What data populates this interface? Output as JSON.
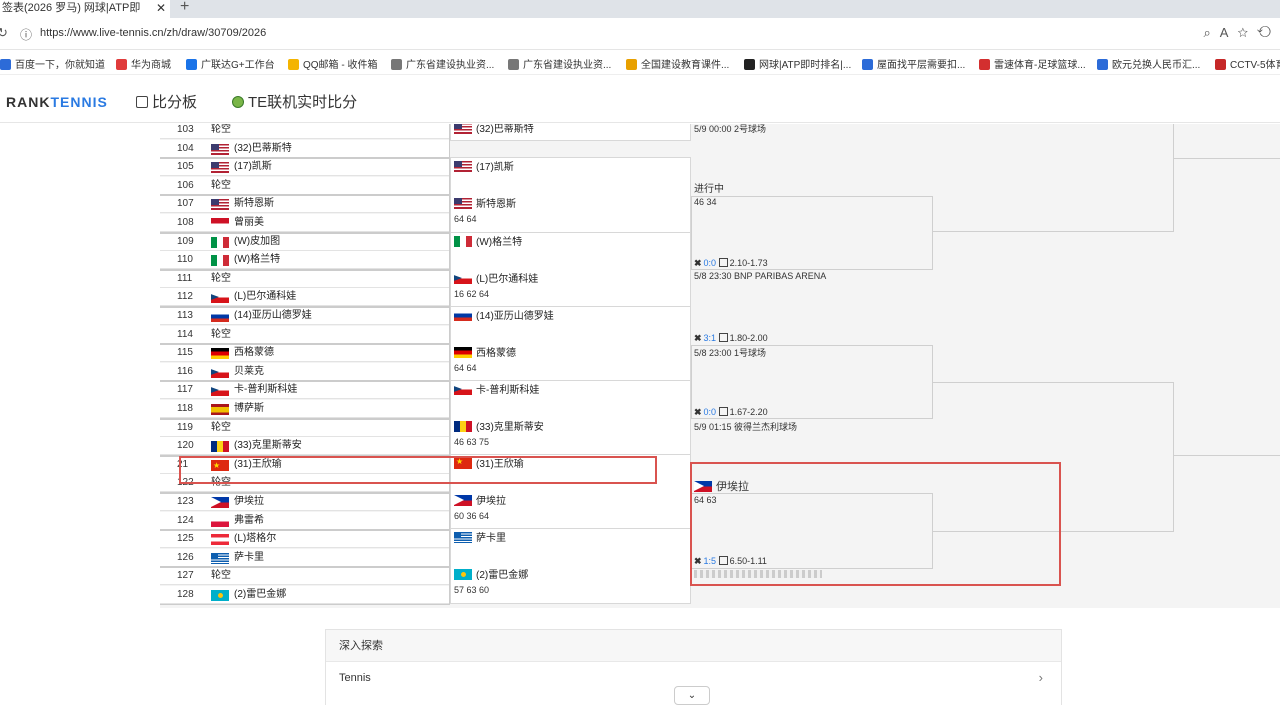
{
  "browser": {
    "tab_title": "签表(2026 罗马) 网球|ATP即",
    "tab_close": "✕",
    "new_tab": "+",
    "url": "https://www.live-tennis.cn/zh/draw/30709/2026",
    "bookmarks": [
      "百度一下，你就知道",
      "华为商城",
      "广联达G+工作台",
      "QQ邮箱 - 收件箱",
      "广东省建设执业资...",
      "广东省建设执业资...",
      "全国建设教育课件...",
      "网球|ATP即时排名|...",
      "屋面找平层需要扣...",
      "雷速体育-足球篮球...",
      "欧元兑换人民币汇...",
      "CCTV-5体育"
    ]
  },
  "site": {
    "logo_a": "RANK",
    "logo_b": "TENNIS",
    "nav_score": "比分板",
    "nav_live": "TE联机实时比分"
  },
  "draw": {
    "r1": [
      {
        "no": "103",
        "name": "轮空",
        "flag": ""
      },
      {
        "no": "104",
        "name": "(32)巴蒂斯特",
        "flag": "us"
      },
      {
        "no": "105",
        "name": "(17)凯斯",
        "flag": "us"
      },
      {
        "no": "106",
        "name": "轮空",
        "flag": ""
      },
      {
        "no": "107",
        "name": "斯特恩斯",
        "flag": "us"
      },
      {
        "no": "108",
        "name": "曾丽美",
        "flag": "id"
      },
      {
        "no": "109",
        "name": "(W)皮加图",
        "flag": "it"
      },
      {
        "no": "110",
        "name": "(W)格兰特",
        "flag": "it"
      },
      {
        "no": "111",
        "name": "轮空",
        "flag": ""
      },
      {
        "no": "112",
        "name": "(L)巴尔通科娃",
        "flag": "cz"
      },
      {
        "no": "113",
        "name": "(14)亚历山德罗娃",
        "flag": "ru"
      },
      {
        "no": "114",
        "name": "轮空",
        "flag": ""
      },
      {
        "no": "115",
        "name": "西格蒙德",
        "flag": "de"
      },
      {
        "no": "116",
        "name": "贝莱克",
        "flag": "cz"
      },
      {
        "no": "117",
        "name": "卡-普利斯科娃",
        "flag": "cz"
      },
      {
        "no": "118",
        "name": "博萨斯",
        "flag": "es"
      },
      {
        "no": "119",
        "name": "轮空",
        "flag": ""
      },
      {
        "no": "120",
        "name": "(33)克里斯蒂安",
        "flag": "ro"
      },
      {
        "no": "21",
        "name": "(31)王欣瑜",
        "flag": "cn"
      },
      {
        "no": "122",
        "name": "轮空",
        "flag": ""
      },
      {
        "no": "123",
        "name": "伊埃拉",
        "flag": "ph"
      },
      {
        "no": "124",
        "name": "弗雷希",
        "flag": "pl"
      },
      {
        "no": "125",
        "name": "(L)塔格尔",
        "flag": "at"
      },
      {
        "no": "126",
        "name": "萨卡里",
        "flag": "gr"
      },
      {
        "no": "127",
        "name": "轮空",
        "flag": ""
      },
      {
        "no": "128",
        "name": "(2)雷巴金娜",
        "flag": "kz"
      }
    ],
    "r2": [
      {
        "a": "(32)巴蒂斯特",
        "af": "us",
        "b": "",
        "bf": "",
        "score": ""
      },
      {
        "a": "(17)凯斯",
        "af": "us",
        "b": "斯特恩斯",
        "bf": "us",
        "score": "64 64"
      },
      {
        "a": "(W)格兰特",
        "af": "it",
        "b": "(L)巴尔通科娃",
        "bf": "cz",
        "score": "16 62 64"
      },
      {
        "a": "(14)亚历山德罗娃",
        "af": "ru",
        "b": "西格蒙德",
        "bf": "de",
        "score": "64 64"
      },
      {
        "a": "卡-普利斯科娃",
        "af": "cz",
        "b": "(33)克里斯蒂安",
        "bf": "ro",
        "score": "46 63 75"
      },
      {
        "a": "(31)王欣瑜",
        "af": "cn",
        "b": "伊埃拉",
        "bf": "ph",
        "score": "60 36 64"
      },
      {
        "a": "萨卡里",
        "af": "gr",
        "b": "(2)雷巴金娜",
        "bf": "kz",
        "score": "57 63 60"
      }
    ],
    "r3": {
      "m1_info": "5/9 00:00 2号球场",
      "m2_status": "进行中",
      "m2_score": "46 34",
      "m3_odds_h": "0:0",
      "m3_odds": "2.10-1.73",
      "m3_info": "5/8 23:30 BNP PARIBAS ARENA",
      "m4_odds_h": "3:1",
      "m4_odds": "1.80-2.00",
      "m4_info": "5/8 23:00 1号球场",
      "m5_odds_h": "0:0",
      "m5_odds": "1.67-2.20",
      "m5_info": "5/9 01:15 彼得兰杰利球场",
      "m6_winner": "伊埃拉",
      "m6_score": "64 63",
      "m7_odds_h": "1:5",
      "m7_odds": "6.50-1.11"
    }
  },
  "explore": {
    "title": "深入探索",
    "item": "Tennis",
    "chevron": "›"
  },
  "scroll_btn": "⌄"
}
